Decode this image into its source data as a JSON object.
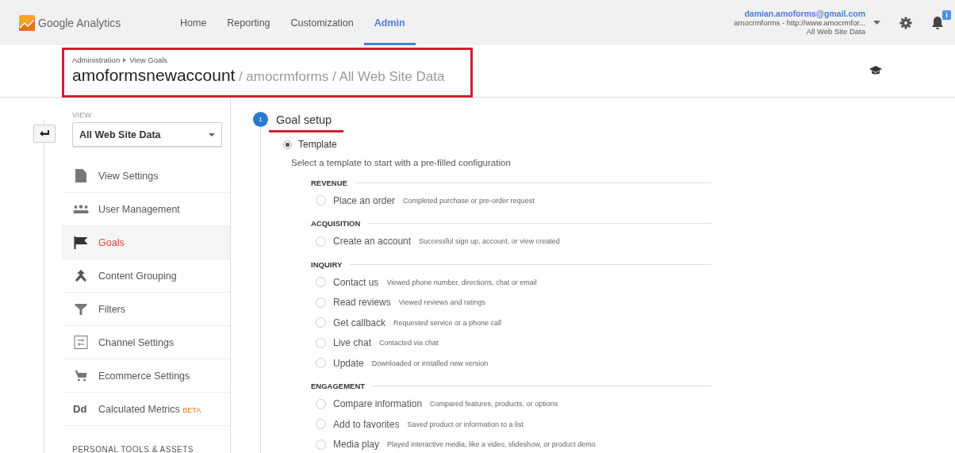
{
  "header": {
    "product": "Google Analytics",
    "nav": [
      {
        "label": "Home",
        "selected": false
      },
      {
        "label": "Reporting",
        "selected": false
      },
      {
        "label": "Customization",
        "selected": false
      },
      {
        "label": "Admin",
        "selected": true
      }
    ],
    "account": {
      "email": "damian.amoforms@gmail.com",
      "property": "amocrmforms - http://www.amocrmfor...",
      "view": "All Web Site Data"
    },
    "notification_badge": "i"
  },
  "breadcrumb": [
    "Administration",
    "View Goals"
  ],
  "page_title": {
    "account": "amoformsnewaccount",
    "path": "/ amocrmforms / All Web Site Data"
  },
  "sidebar": {
    "view_label": "VIEW",
    "view_select": "All Web Site Data",
    "items": [
      {
        "label": "View Settings",
        "selected": false
      },
      {
        "label": "User Management",
        "selected": false
      },
      {
        "label": "Goals",
        "selected": true
      },
      {
        "label": "Content Grouping",
        "selected": false
      },
      {
        "label": "Filters",
        "selected": false
      },
      {
        "label": "Channel Settings",
        "selected": false
      },
      {
        "label": "Ecommerce Settings",
        "selected": false
      },
      {
        "label": "Calculated Metrics",
        "selected": false,
        "icon_text": "Dd",
        "badge": "BETA"
      }
    ],
    "section": "PERSONAL TOOLS & ASSETS"
  },
  "goal_setup": {
    "step": "1",
    "title": "Goal setup",
    "template": {
      "label": "Template",
      "selected": true
    },
    "description": "Select a template to start with a pre-filled configuration",
    "groups": [
      {
        "name": "REVENUE",
        "options": [
          {
            "label": "Place an order",
            "description": "Completed purchase or pre-order request",
            "selected": false
          }
        ]
      },
      {
        "name": "ACQUISITION",
        "options": [
          {
            "label": "Create an account",
            "description": "Successful sign up, account, or view created",
            "selected": false
          }
        ]
      },
      {
        "name": "INQUIRY",
        "options": [
          {
            "label": "Contact us",
            "description": "Viewed phone number, directions, chat or email",
            "selected": false
          },
          {
            "label": "Read reviews",
            "description": "Viewed reviews and ratings",
            "selected": false
          },
          {
            "label": "Get callback",
            "description": "Requested service or a phone call",
            "selected": false
          },
          {
            "label": "Live chat",
            "description": "Contacted via chat",
            "selected": false
          },
          {
            "label": "Update",
            "description": "Downloaded or installed new version",
            "selected": false
          }
        ]
      },
      {
        "name": "ENGAGEMENT",
        "options": [
          {
            "label": "Compare information",
            "description": "Compared features, products, or options",
            "selected": false
          },
          {
            "label": "Add to favorites",
            "description": "Saved product or information to a list",
            "selected": false
          },
          {
            "label": "Media play",
            "description": "Played interactive media, like a video, slideshow, or product demo",
            "selected": false
          }
        ]
      }
    ]
  }
}
